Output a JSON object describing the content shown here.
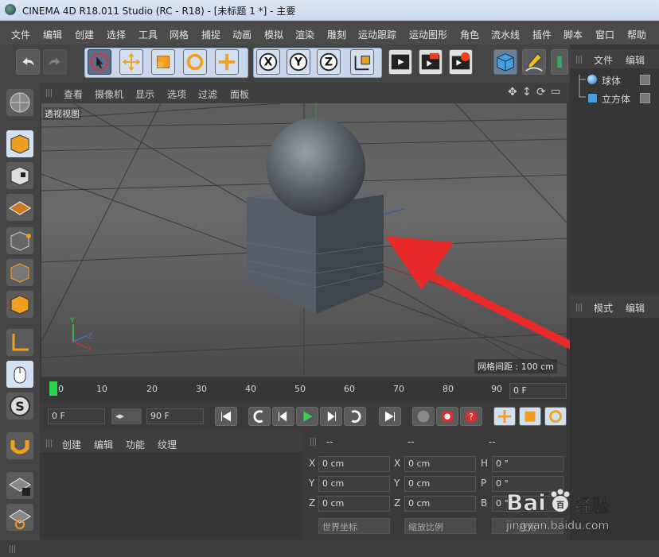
{
  "window": {
    "title": "CINEMA 4D R18.011 Studio (RC - R18) - [未标题 1 *] - 主要"
  },
  "menu": [
    "文件",
    "编辑",
    "创建",
    "选择",
    "工具",
    "网格",
    "捕捉",
    "动画",
    "模拟",
    "渲染",
    "雕刻",
    "运动跟踪",
    "运动图形",
    "角色",
    "流水线",
    "插件",
    "脚本",
    "窗口",
    "帮助"
  ],
  "toolbar": {
    "icons": [
      "undo-icon",
      "redo-icon",
      "select-arrow-icon",
      "move-icon",
      "scale-icon",
      "rotate-icon",
      "move-plus-icon",
      "x-axis-icon",
      "y-axis-icon",
      "z-axis-icon",
      "coord-system-icon",
      "render-view-icon",
      "render-picture-icon",
      "render-settings-icon",
      "cube-icon",
      "pen-icon"
    ]
  },
  "viewport": {
    "menu": [
      "查看",
      "摄像机",
      "显示",
      "选项",
      "过滤",
      "面板"
    ],
    "label": "透视视图",
    "grid_info": "网格间距 : 100 cm"
  },
  "timeline": {
    "ticks": [
      "0",
      "10",
      "20",
      "30",
      "40",
      "50",
      "60",
      "70",
      "80",
      "90"
    ],
    "current_frame": "0 F",
    "start_frame": "0 F",
    "end_frame": "90 F"
  },
  "material_panel": {
    "menu": [
      "创建",
      "编辑",
      "功能",
      "纹理"
    ]
  },
  "coord_panel": {
    "headers": [
      "--",
      "--",
      "--"
    ],
    "rows": [
      {
        "a": "X",
        "av": "0 cm",
        "b": "X",
        "bv": "0 cm",
        "c": "H",
        "cv": "0 °"
      },
      {
        "a": "Y",
        "av": "0 cm",
        "b": "Y",
        "bv": "0 cm",
        "c": "P",
        "cv": "0 °"
      },
      {
        "a": "Z",
        "av": "0 cm",
        "b": "Z",
        "bv": "0 cm",
        "c": "B",
        "cv": "0 °"
      }
    ],
    "world_coords": "世界坐标",
    "scale_ratio": "缩放比例",
    "apply": "应用"
  },
  "object_panel": {
    "menu": [
      "文件",
      "编辑"
    ],
    "objects": [
      "球体",
      "立方体"
    ]
  },
  "attribute_panel": {
    "menu": [
      "模式",
      "编辑"
    ]
  },
  "watermark": {
    "brand": "Bai",
    "brand2": "百",
    "site_cn": "经验",
    "url": "jingyan.baidu.com"
  }
}
